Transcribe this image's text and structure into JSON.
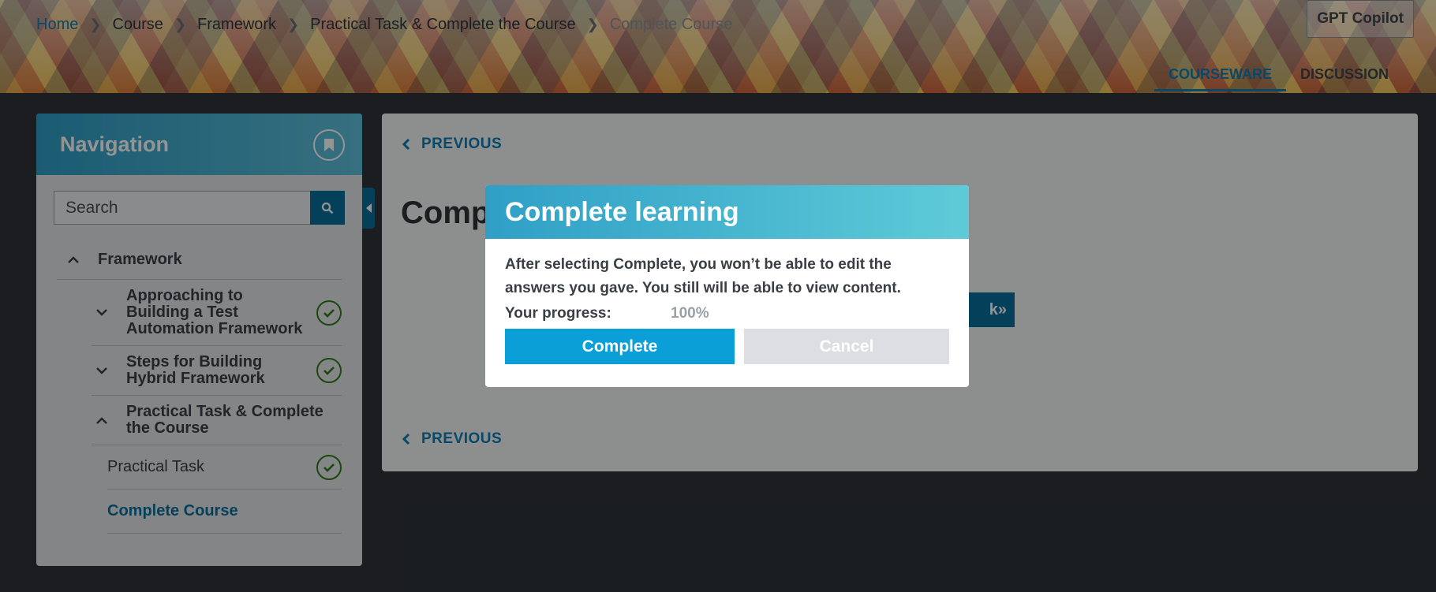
{
  "breadcrumb": {
    "items": [
      "Home",
      "Course",
      "Framework",
      "Practical Task & Complete the Course"
    ],
    "current": "Complete Course"
  },
  "header": {
    "copilot_label": "GPT Copilot",
    "tabs": [
      {
        "label": "COURSEWARE",
        "active": true
      },
      {
        "label": "DISCUSSION",
        "active": false
      }
    ]
  },
  "sidebar": {
    "title": "Navigation",
    "search_placeholder": "Search",
    "section": "Framework",
    "subsections": [
      {
        "label": "Approaching to Building a Test Automation Framework",
        "expanded": false,
        "completed": true
      },
      {
        "label": "Steps for Building Hybrid Framework",
        "expanded": false,
        "completed": true
      },
      {
        "label": "Practical Task & Complete the Course",
        "expanded": true,
        "completed": false
      }
    ],
    "units": [
      {
        "label": "Practical Task",
        "completed": true,
        "current": false
      },
      {
        "label": "Complete Course",
        "completed": false,
        "current": true
      }
    ]
  },
  "content": {
    "previous_label": "PREVIOUS",
    "title_partial": "Comp",
    "hidden_button_partial": "k»"
  },
  "modal": {
    "title": "Complete learning",
    "message": "After selecting Complete, you won’t be able to edit the answers you gave. You still will be able to view content.",
    "progress_label": "Your progress:",
    "progress_value": "100%",
    "progress_fraction": 1.0,
    "complete_label": "Complete",
    "cancel_label": "Cancel"
  },
  "colors": {
    "accent": "#0a9fd6",
    "link": "#0f7db3",
    "success": "#2e7d18"
  }
}
